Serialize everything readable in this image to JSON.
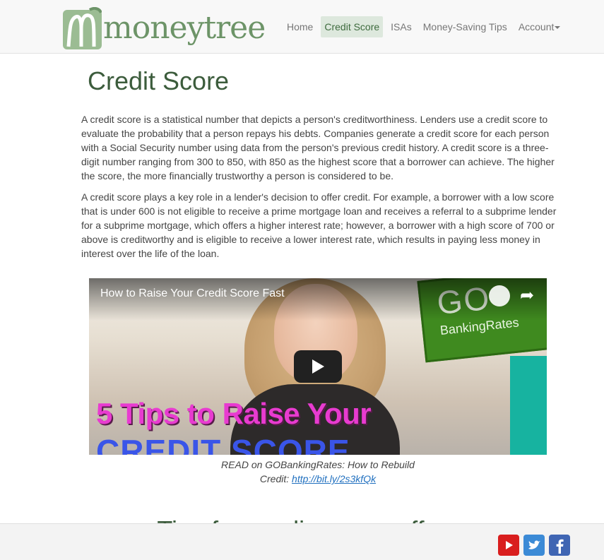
{
  "brand": {
    "name": "moneytree"
  },
  "nav": {
    "items": [
      {
        "label": "Home",
        "active": false
      },
      {
        "label": "Credit Score",
        "active": true
      },
      {
        "label": "ISAs",
        "active": false
      },
      {
        "label": "Money-Saving Tips",
        "active": false
      },
      {
        "label": "Account",
        "active": false,
        "dropdown": true
      }
    ]
  },
  "page": {
    "title": "Credit Score",
    "paragraphs": [
      "A credit score is a statistical number that depicts a person's creditworthiness. Lenders use a credit score to evaluate the probability that a person repays his debts. Companies generate a credit score for each person with a Social Security number using data from the person's previous credit history. A credit score is a three-digit number ranging from 300 to 850, with 850 as the highest score that a borrower can achieve. The higher the score, the more financially trustworthy a person is considered to be.",
      "A credit score plays a key role in a lender's decision to offer credit. For example, a borrower with a low score that is under 600 is not eligible to receive a prime mortgage loan and receives a referral to a subprime lender for a subprime mortgage, which offers a higher interest rate; however, a borrower with a high score of 700 or above is creditworthy and is eligible to receive a lower interest rate, which results in paying less money in interest over the life of the loan."
    ]
  },
  "video": {
    "title": "How to Raise Your Credit Score Fast",
    "sign_text": "GO",
    "sign_subtext": "BankingRates",
    "caption_line1": "5 Tips to Raise Your",
    "caption_line2": "CREDIT SCORE"
  },
  "credit": {
    "prefix_line1": "READ on GOBankingRates: How to Rebuild",
    "prefix_line2": "Credit: ",
    "link_text": "http://bit.ly/2s3kfQk"
  },
  "section": {
    "heading": "Tips for reading your offer"
  },
  "footer": {
    "social": [
      {
        "name": "youtube-icon"
      },
      {
        "name": "twitter-icon"
      },
      {
        "name": "facebook-icon"
      }
    ]
  },
  "colors": {
    "brand_green": "#6d9468",
    "heading_green": "#3c5c3c",
    "active_nav_bg": "#dde8dd",
    "link_blue": "#1f6fbf"
  }
}
